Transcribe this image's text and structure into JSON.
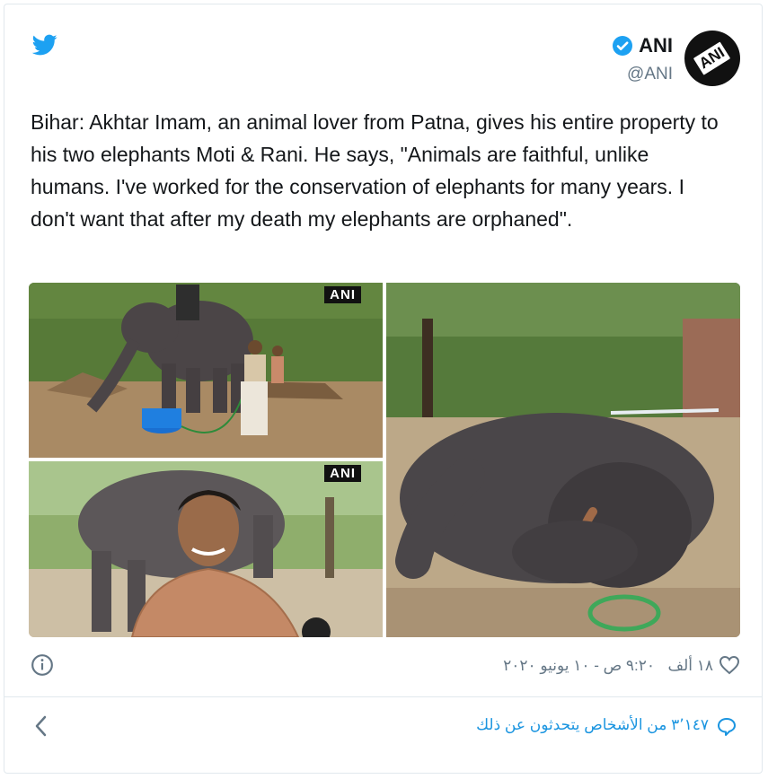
{
  "account": {
    "display_name": "ANI",
    "handle": "@ANI",
    "avatar_text": "ANI"
  },
  "tweet": {
    "text": "Bihar: Akhtar Imam, an animal lover from Patna, gives his entire property to his two elephants Moti & Rani. He says, \"Animals are faithful, unlike humans. I've worked for the conservation of elephants for many years. I don't want that after my death my elephants are orphaned\".",
    "images": [
      {
        "watermark": "ANI"
      },
      {
        "watermark": "ANI"
      },
      {
        "watermark": ""
      }
    ]
  },
  "footer": {
    "like_count": "١٨ ألف",
    "timestamp": "٩:٢٠ ص - ١٠ يونيو ٢٠٢٠",
    "conversation": "٣٬١٤٧ من الأشخاص يتحدثون عن ذلك"
  },
  "colors": {
    "accent": "#1da1f2",
    "link": "#1b95e0",
    "muted": "#657786",
    "text": "#14171a",
    "border": "#e1e8ed"
  },
  "icons": [
    "twitter-bird-icon",
    "verified-badge-icon",
    "info-icon",
    "heart-icon",
    "chevron-left-icon",
    "reply-bubble-icon"
  ]
}
